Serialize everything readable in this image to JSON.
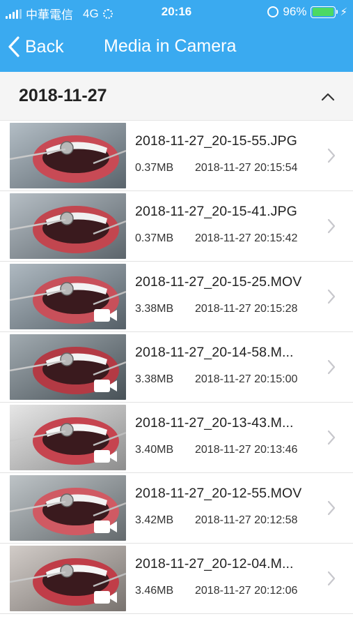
{
  "status_bar": {
    "carrier": "中華電信",
    "network": "4G",
    "time": "20:16",
    "battery_percent": "96%",
    "battery_level": 0.96,
    "battery_color": "#4cd964"
  },
  "nav": {
    "back_label": "Back",
    "title": "Media in Camera",
    "accent_color": "#3aaaf0"
  },
  "section": {
    "date": "2018-11-27"
  },
  "files": [
    {
      "name": "2018-11-27_20-15-55.JPG",
      "size": "0.37MB",
      "date": "2018-11-27 20:15:54",
      "type": "photo",
      "icon": "photo-thumbnail"
    },
    {
      "name": "2018-11-27_20-15-41.JPG",
      "size": "0.37MB",
      "date": "2018-11-27 20:15:42",
      "type": "photo",
      "icon": "photo-thumbnail"
    },
    {
      "name": "2018-11-27_20-15-25.MOV",
      "size": "3.38MB",
      "date": "2018-11-27 20:15:28",
      "type": "video",
      "icon": "video-camera-icon"
    },
    {
      "name": "2018-11-27_20-14-58.M...",
      "size": "3.38MB",
      "date": "2018-11-27 20:15:00",
      "type": "video",
      "icon": "video-camera-icon"
    },
    {
      "name": "2018-11-27_20-13-43.M...",
      "size": "3.40MB",
      "date": "2018-11-27 20:13:46",
      "type": "video",
      "icon": "video-camera-icon"
    },
    {
      "name": "2018-11-27_20-12-55.MOV",
      "size": "3.42MB",
      "date": "2018-11-27 20:12:58",
      "type": "video",
      "icon": "video-camera-icon"
    },
    {
      "name": "2018-11-27_20-12-04.M...",
      "size": "3.46MB",
      "date": "2018-11-27 20:12:06",
      "type": "video",
      "icon": "video-camera-icon"
    }
  ]
}
